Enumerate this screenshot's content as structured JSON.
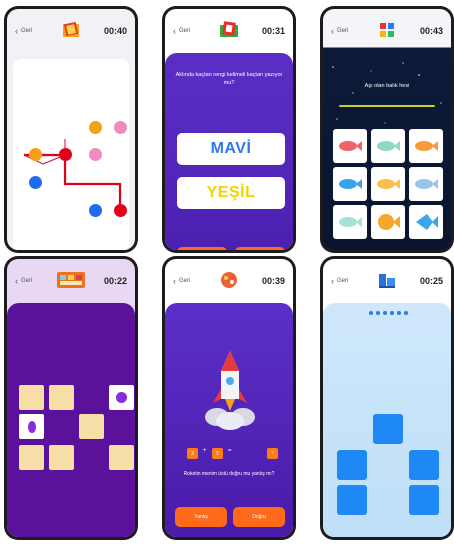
{
  "colors": {
    "frame": "#1c1c1e",
    "purple": "#5a2fc4",
    "orange": "#ff6a1a",
    "blue": "#1e88f5",
    "red": "#e0001b",
    "pink": "#f08bc2",
    "dot_orange": "#f8a015"
  },
  "phones": [
    {
      "back_label": "Geri",
      "timer": "00:40",
      "icon": "book-icon"
    },
    {
      "back_label": "Geri",
      "timer": "00:31",
      "icon": "book-icon",
      "question": "Aklında kaçtan rengi kelimeli kaçtan yazıyor mu?",
      "word_top": "MAVİ",
      "word_bottom": "YEŞİL"
    },
    {
      "back_label": "Geri",
      "timer": "00:43",
      "icon": "grid-icon",
      "question": "Aşı olan balık hesi"
    },
    {
      "back_label": "Geri",
      "timer": "00:22",
      "icon": "cards-icon"
    },
    {
      "back_label": "Geri",
      "timer": "00:39",
      "icon": "rocket-icon",
      "question": "Roketin menim üstü doğru mu yanlış mı?",
      "equation": [
        "3",
        "+",
        "5",
        "=",
        "?"
      ],
      "btn_left": "Yanlış",
      "btn_right": "Doğru"
    },
    {
      "back_label": "Geri",
      "timer": "00:25",
      "icon": "blocks-icon"
    }
  ]
}
